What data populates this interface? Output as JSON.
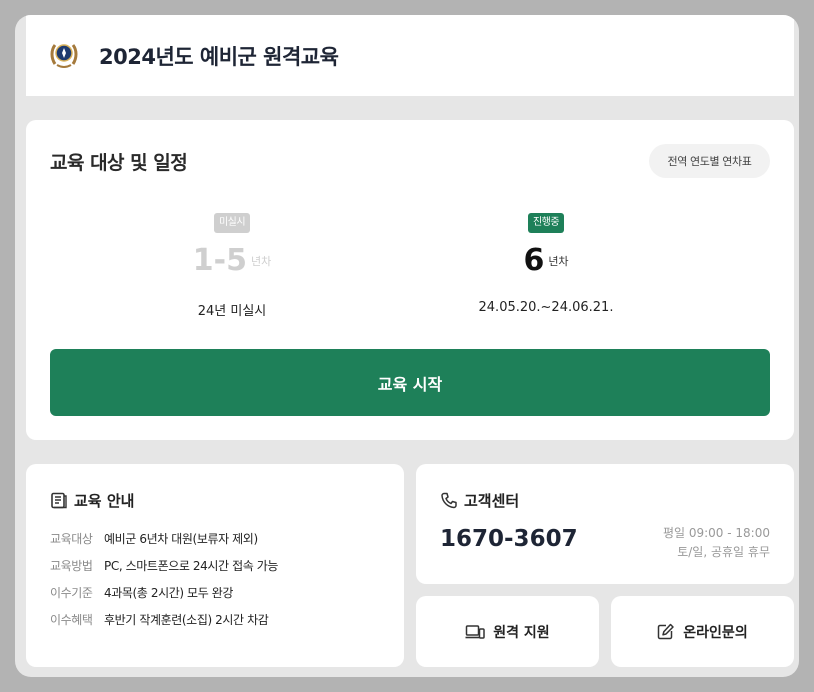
{
  "header": {
    "title": "2024년도 예비군 원격교육",
    "emblem_icon": "reserve-forces-emblem-icon"
  },
  "schedule": {
    "title": "교육 대상 및 일정",
    "year_table_label": "전역 연도별 연차표",
    "groups": [
      {
        "status": "미실시",
        "range": "1-5",
        "unit": "년차",
        "caption": "24년 미실시"
      },
      {
        "status": "진행중",
        "range": "6",
        "unit": "년차",
        "caption": "24.05.20.~24.06.21."
      }
    ],
    "start_label": "교육 시작"
  },
  "info": {
    "title": "교육 안내",
    "icon": "book-icon",
    "rows": [
      {
        "key": "교육대상",
        "value": "예비군 6년차 대원(보류자 제외)"
      },
      {
        "key": "교육방법",
        "value": "PC, 스마트폰으로 24시간 접속 가능"
      },
      {
        "key": "이수기준",
        "value": "4과목(총 2시간) 모두 완강"
      },
      {
        "key": "이수혜택",
        "value": "후반기 작계훈련(소집) 2시간 차감"
      }
    ]
  },
  "customer_center": {
    "title": "고객센터",
    "icon": "phone-icon",
    "phone": "1670-3607",
    "hours_weekday": "평일 09:00 - 18:00",
    "hours_weekend": "토/일, 공휴일 휴무"
  },
  "actions": {
    "remote_label": "원격 지원",
    "remote_icon": "remote-devices-icon",
    "inquiry_label": "온라인문의",
    "inquiry_icon": "edit-icon"
  },
  "colors": {
    "accent": "#1e8059",
    "title": "#1e2535",
    "badge_inactive": "#cfcfcf",
    "background": "#e6e6e6"
  }
}
